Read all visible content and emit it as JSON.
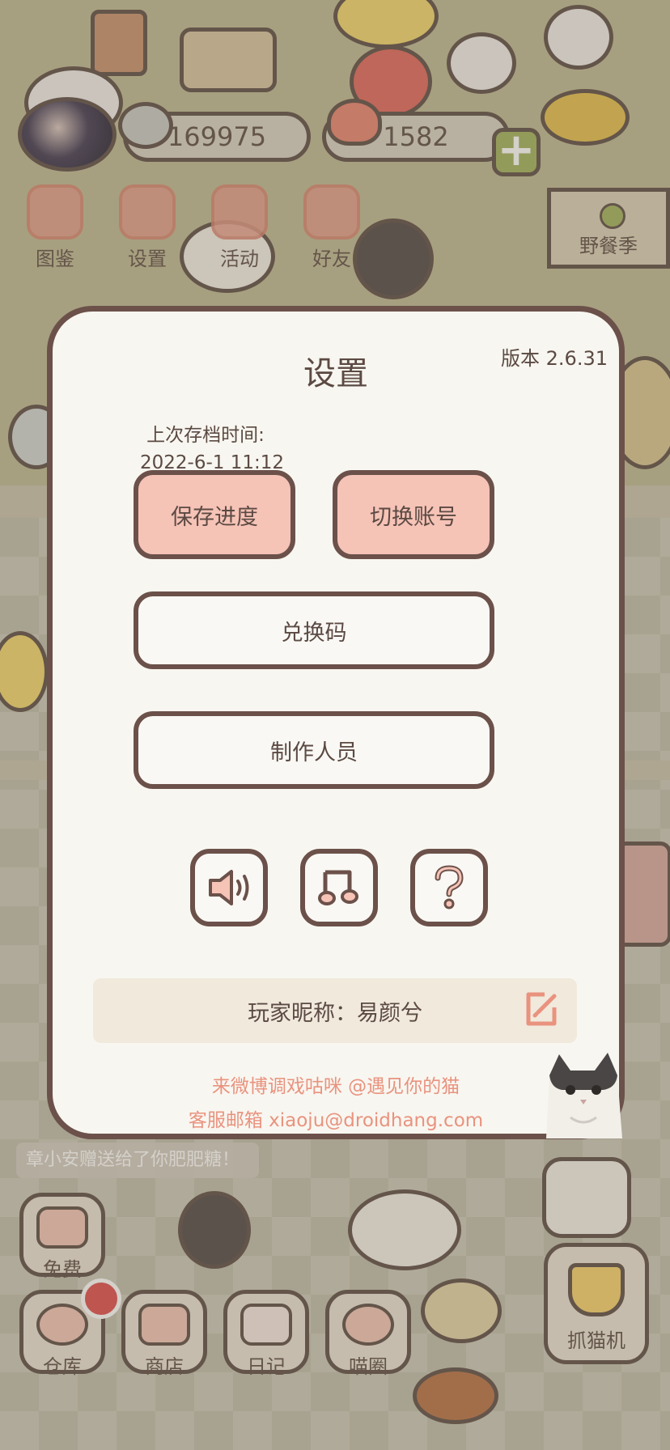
{
  "hud": {
    "coins": "169975",
    "hearts": "1582",
    "menu": [
      {
        "label": "图鉴",
        "icon": "cat-book-icon"
      },
      {
        "label": "设置",
        "icon": "gear-icon"
      },
      {
        "label": "活动",
        "icon": "gift-icon"
      },
      {
        "label": "好友",
        "icon": "friends-icon"
      }
    ],
    "event_label": "野餐季"
  },
  "dialog": {
    "title": "设置",
    "version": "版本 2.6.31",
    "last_save_label": "上次存档时间:",
    "last_save_time": "2022-6-1 11:12",
    "save_button": "保存进度",
    "switch_account_button": "切换账号",
    "redeem_button": "兑换码",
    "credits_button": "制作人员",
    "nickname_label": "玩家昵称：易颜兮",
    "weibo_text": "来微博调戏咕咪 @遇见你的猫",
    "email_text": "客服邮箱 xiaoju@droidhang.com"
  },
  "gift_message": "章小安赠送给了你肥肥糖！",
  "bottom_bar": {
    "free": "免费",
    "warehouse": "仓库",
    "shop": "商店",
    "diary": "日记",
    "circle": "喵圈",
    "claw_machine": "抓猫机"
  },
  "colors": {
    "accent_pink": "#f6c3b7",
    "border_brown": "#6b514a",
    "link_salmon": "#e9937f",
    "panel_bg": "#f8f6f0"
  }
}
